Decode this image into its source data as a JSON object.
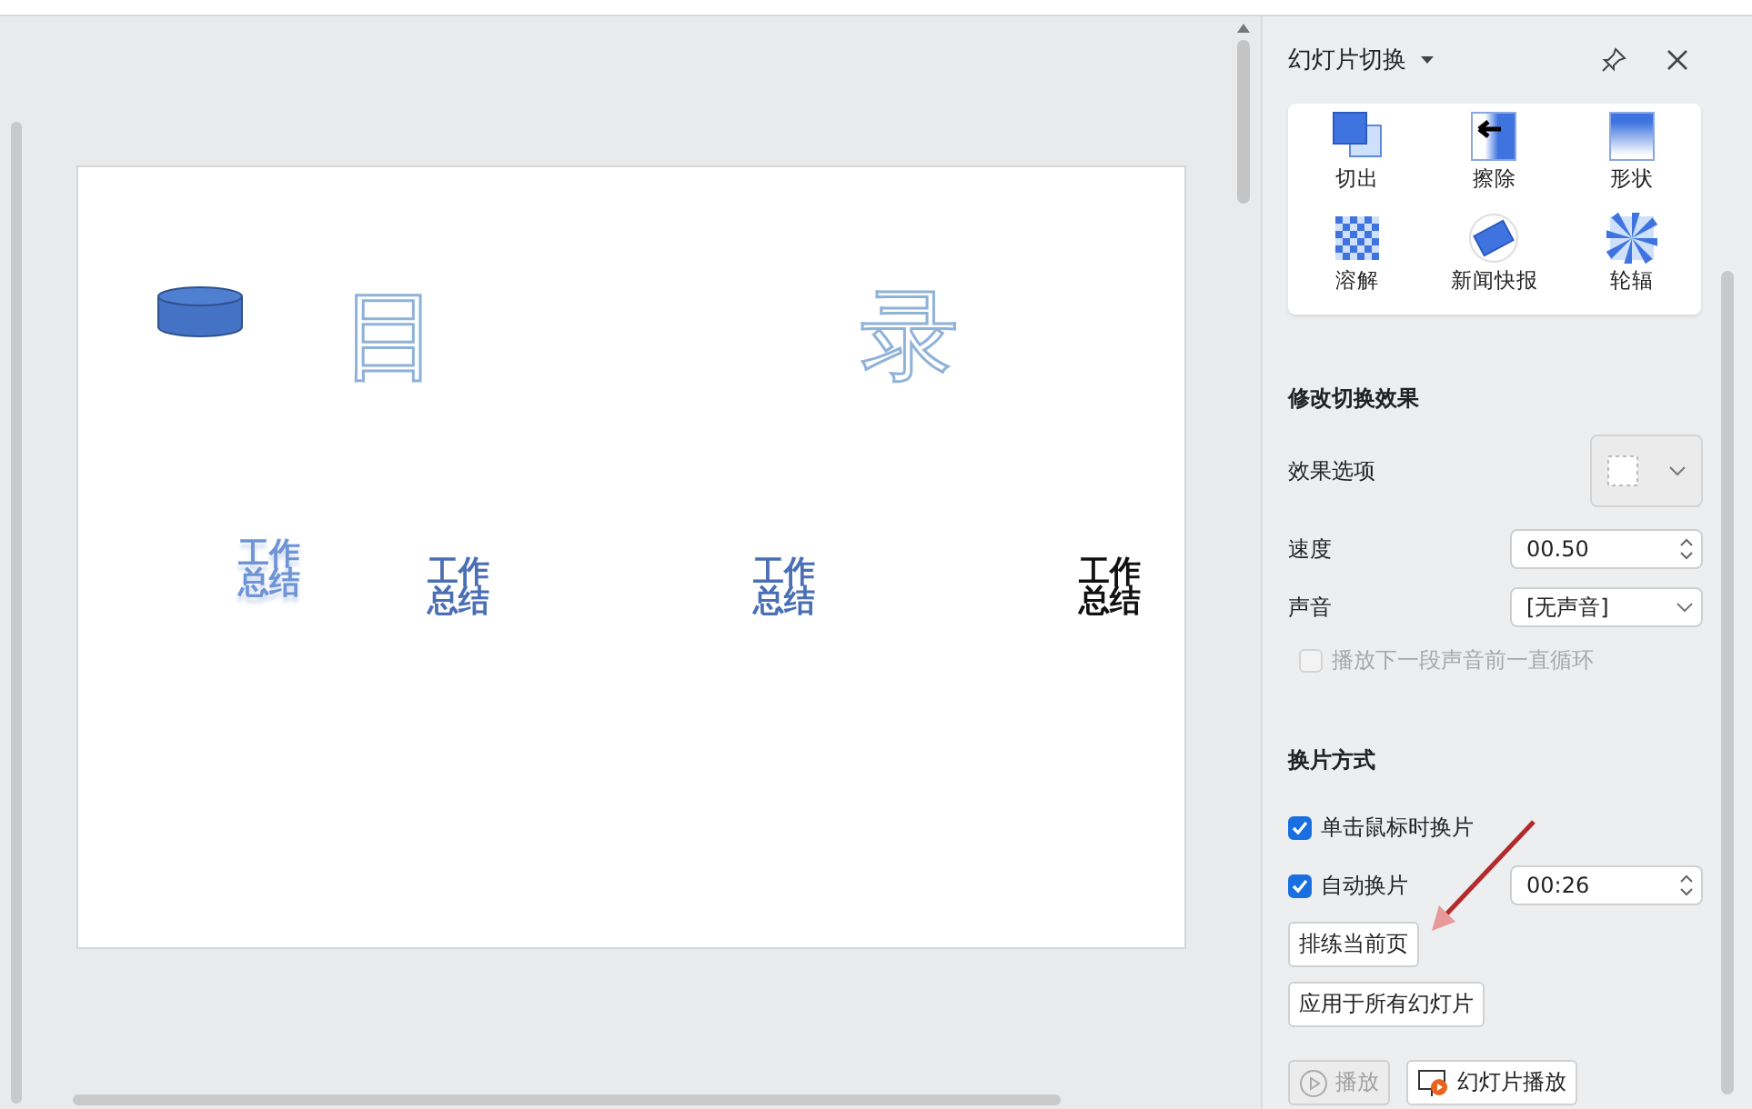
{
  "slide": {
    "title_chars": [
      "目",
      "录"
    ],
    "items": [
      {
        "text": "工作总结",
        "color": "#6f94d6",
        "reflection": true
      },
      {
        "text": "工作总结",
        "color": "#4a6fb5",
        "reflection": false
      },
      {
        "text": "工作总结",
        "color": "#4a6fb5",
        "reflection": false
      },
      {
        "text": "工作总结",
        "color": "#111111",
        "reflection": false
      }
    ]
  },
  "panel": {
    "title": "幻灯片切换",
    "effects": [
      {
        "label": "切出",
        "kind": "cut"
      },
      {
        "label": "擦除",
        "kind": "wipe"
      },
      {
        "label": "形状",
        "kind": "shape"
      },
      {
        "label": "溶解",
        "kind": "dissolve"
      },
      {
        "label": "新闻快报",
        "kind": "news"
      },
      {
        "label": "轮辐",
        "kind": "wheel"
      }
    ],
    "modify": {
      "heading": "修改切换效果",
      "option_label": "效果选项",
      "option_disabled": true,
      "speed_label": "速度",
      "speed": "00.50",
      "sound_label": "声音",
      "sound": "[无声音]",
      "loop": {
        "label": "播放下一段声音前一直循环",
        "checked": false,
        "disabled": true
      }
    },
    "advance": {
      "heading": "换片方式",
      "on_click": {
        "label": "单击鼠标时换片",
        "checked": true
      },
      "auto": {
        "label": "自动换片",
        "checked": true,
        "time": "00:26"
      }
    },
    "actions": [
      {
        "label": "排练当前页",
        "disabled": false
      },
      {
        "label": "应用于所有幻灯片",
        "disabled": false
      }
    ],
    "footer": [
      {
        "label": "播放",
        "kind": "play",
        "disabled": true
      },
      {
        "label": "幻灯片播放",
        "kind": "show",
        "disabled": false
      }
    ]
  }
}
